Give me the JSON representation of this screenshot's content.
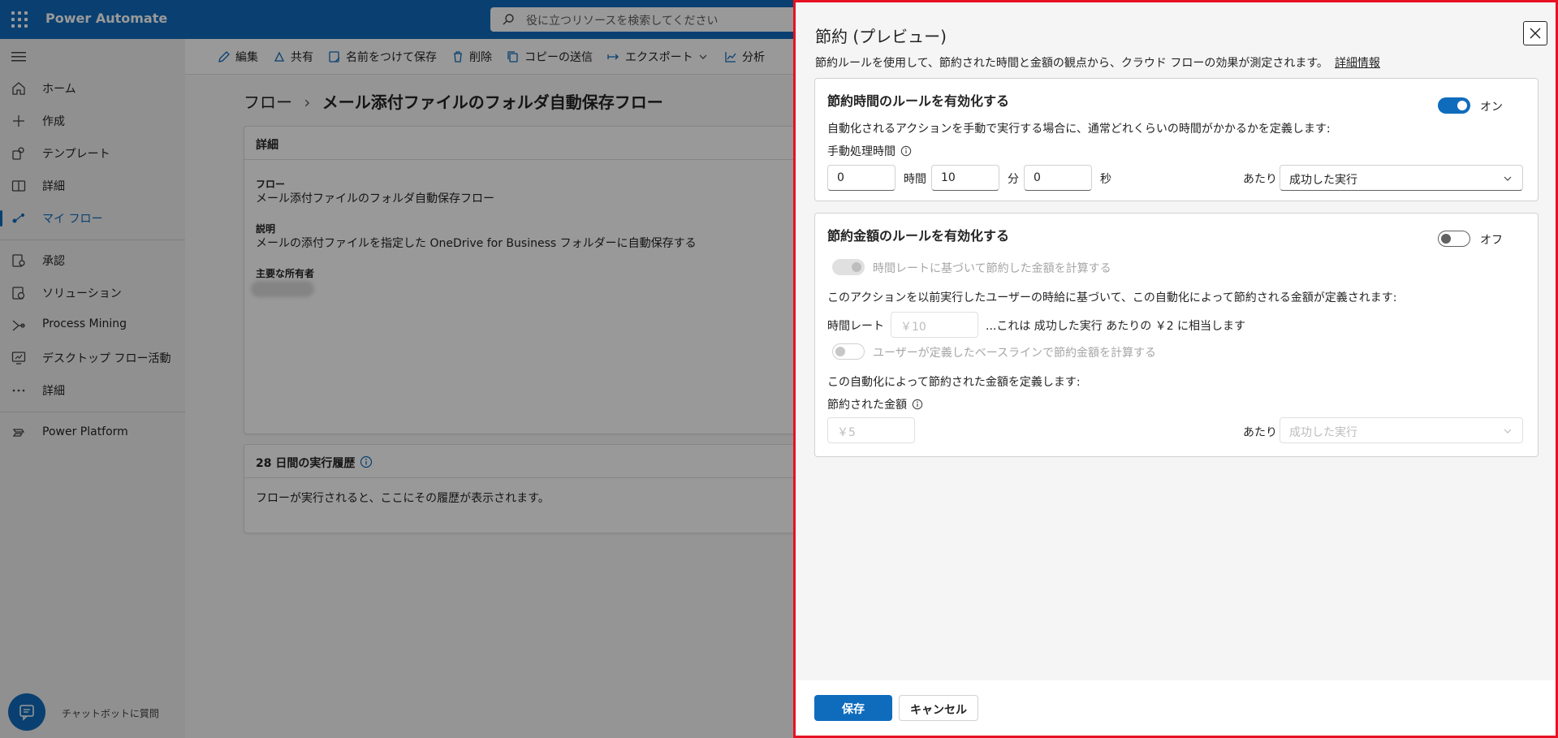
{
  "app": {
    "brand": "Power Automate",
    "search_placeholder": "役に立つリソースを検索してください"
  },
  "nav": {
    "items": [
      {
        "label": "ホーム",
        "icon": "home-icon"
      },
      {
        "label": "作成",
        "icon": "plus-icon"
      },
      {
        "label": "テンプレート",
        "icon": "template-icon"
      },
      {
        "label": "詳細",
        "icon": "book-icon"
      },
      {
        "label": "マイ フロー",
        "icon": "flow-icon",
        "active": true
      },
      {
        "label": "承認",
        "icon": "approval-icon"
      },
      {
        "label": "ソリューション",
        "icon": "solution-icon"
      },
      {
        "label": "Process Mining",
        "icon": "process-mining-icon"
      },
      {
        "label": "デスクトップ フロー活動",
        "icon": "desktop-flow-icon"
      },
      {
        "label": "詳細",
        "icon": "more-icon"
      },
      {
        "label": "Power Platform",
        "icon": "power-platform-icon"
      }
    ],
    "chatbot_label": "チャットボットに質問"
  },
  "toolbar": {
    "edit": "編集",
    "share": "共有",
    "save_as": "名前をつけて保存",
    "delete": "削除",
    "send_copy": "コピーの送信",
    "export": "エクスポート",
    "analytics": "分析"
  },
  "breadcrumb": {
    "root": "フロー",
    "current": "メール添付ファイルのフォルダ自動保存フロー"
  },
  "details": {
    "title": "詳細",
    "flow_label": "フロー",
    "flow_value": "メール添付ファイルのフォルダ自動保存フロー",
    "desc_label": "説明",
    "desc_value": "メールの添付ファイルを指定した OneDrive for Business フォルダーに自動保存する",
    "owner_label": "主要な所有者"
  },
  "history": {
    "title": "28 日間の実行履歴",
    "empty": "フローが実行されると、ここにその履歴が表示されます。"
  },
  "panel": {
    "title": "節約 (プレビュー)",
    "description": "節約ルールを使用して、節約された時間と金額の観点から、クラウド フローの効果が測定されます。",
    "learn_more": "詳細情報",
    "time_rule": {
      "title": "節約時間のルールを有効化する",
      "toggle_state": "オン",
      "toggle_on": true,
      "desc": "自動化されるアクションを手動で実行する場合に、通常どれくらいの時間がかかるかを定義します:",
      "manual_time_label": "手動処理時間",
      "hours": "0",
      "hours_unit": "時間",
      "minutes": "10",
      "minutes_unit": "分",
      "seconds": "0",
      "seconds_unit": "秒",
      "per_label": "あたり",
      "per_value": "成功した実行"
    },
    "money_rule": {
      "title": "節約金額のルールを有効化する",
      "toggle_state": "オフ",
      "toggle_on": false,
      "rate_toggle_label": "時間レートに基づいて節約した金額を計算する",
      "rate_desc": "このアクションを以前実行したユーザーの時給に基づいて、この自動化によって節約される金額が定義されます:",
      "rate_label": "時間レート",
      "rate_placeholder": "￥10",
      "rate_equiv": "...これは 成功した実行 あたりの ￥2 に相当します",
      "baseline_toggle_label": "ユーザーが定義したベースラインで節約金額を計算する",
      "amount_desc": "この自動化によって節約された金額を定義します:",
      "amount_label": "節約された金額",
      "amount_placeholder": "￥5",
      "per_label": "あたり",
      "per_value": "成功した実行"
    },
    "save_button": "保存",
    "cancel_button": "キャンセル"
  }
}
